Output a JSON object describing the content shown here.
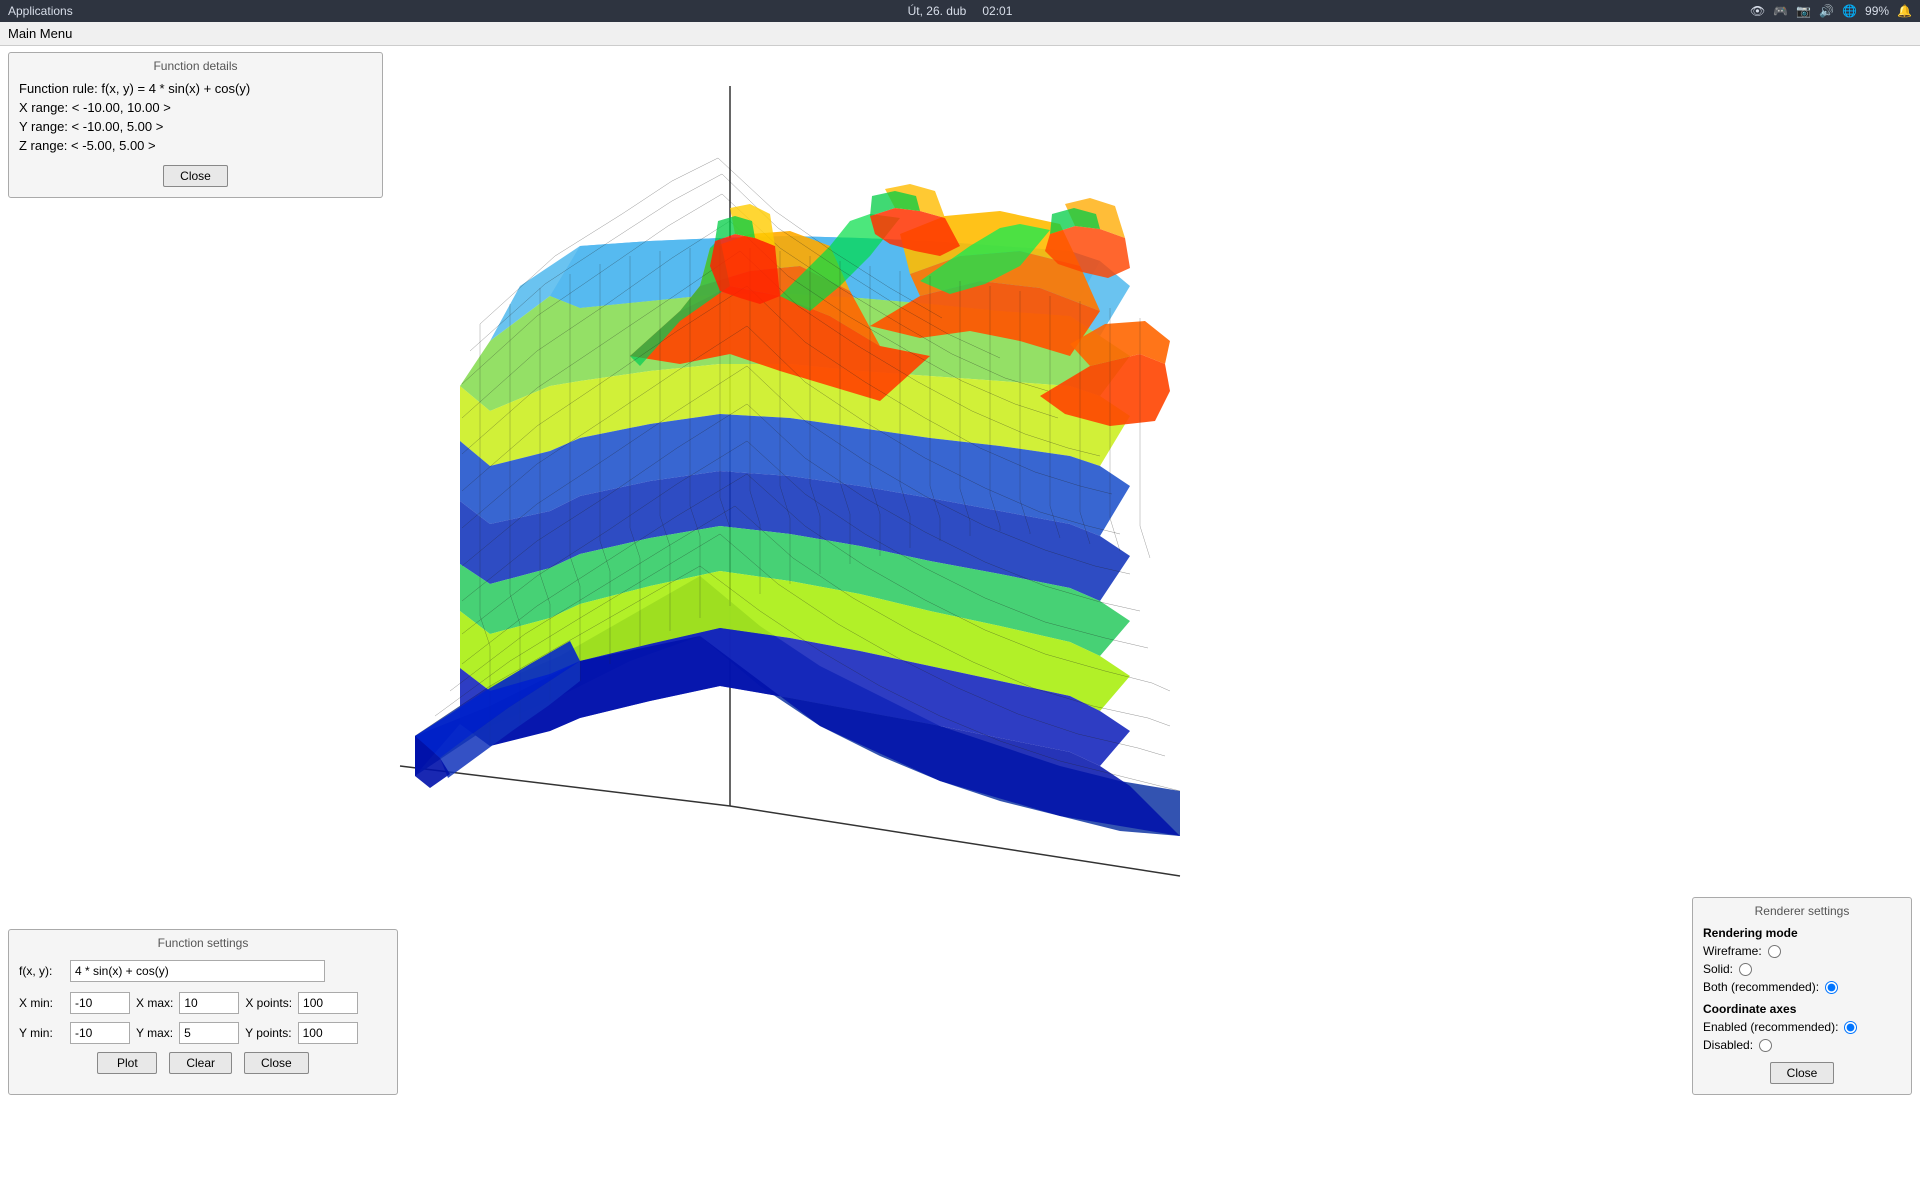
{
  "topbar": {
    "app_label": "Applications",
    "datetime": "Út, 26. dub",
    "time": "02:01",
    "battery": "99%",
    "icons": [
      "eye-icon",
      "gamepad-icon",
      "screenshot-icon",
      "volume-icon",
      "network-icon",
      "battery-icon",
      "notification-icon"
    ]
  },
  "menubar": {
    "main_menu": "Main Menu"
  },
  "function_details": {
    "title": "Function details",
    "rule_label": "Function rule:",
    "rule_value": "f(x, y) = 4 * sin(x) + cos(y)",
    "x_range_label": "X range:",
    "x_range_value": "< -10.00, 10.00 >",
    "y_range_label": "Y range:",
    "y_range_value": "< -10.00, 5.00 >",
    "z_range_label": "Z range:",
    "z_range_value": "< -5.00, 5.00 >",
    "close_button": "Close"
  },
  "function_settings": {
    "title": "Function settings",
    "fxy_label": "f(x, y):",
    "fxy_value": "4 * sin(x) + cos(y)",
    "x_min_label": "X min:",
    "x_min_value": "-10",
    "x_max_label": "X max:",
    "x_max_value": "10",
    "x_points_label": "X points:",
    "x_points_value": "100",
    "y_min_label": "Y min:",
    "y_min_value": "-10",
    "y_max_label": "Y max:",
    "y_max_value": "5",
    "y_points_label": "Y points:",
    "y_points_value": "100",
    "plot_button": "Plot",
    "clear_button": "Clear",
    "close_button": "Close"
  },
  "renderer_settings": {
    "title": "Renderer settings",
    "rendering_mode_label": "Rendering mode",
    "wireframe_label": "Wireframe:",
    "solid_label": "Solid:",
    "both_label": "Both (recommended):",
    "coordinate_axes_label": "Coordinate axes",
    "enabled_label": "Enabled (recommended):",
    "disabled_label": "Disabled:",
    "close_button": "Close",
    "wireframe_checked": false,
    "solid_checked": false,
    "both_checked": true,
    "enabled_checked": true,
    "disabled_checked": false
  },
  "colors": {
    "topbar_bg": "#2e3440",
    "panel_bg": "#f5f5f5",
    "panel_border": "#aaaaaa",
    "accent": "#4a90d9"
  }
}
